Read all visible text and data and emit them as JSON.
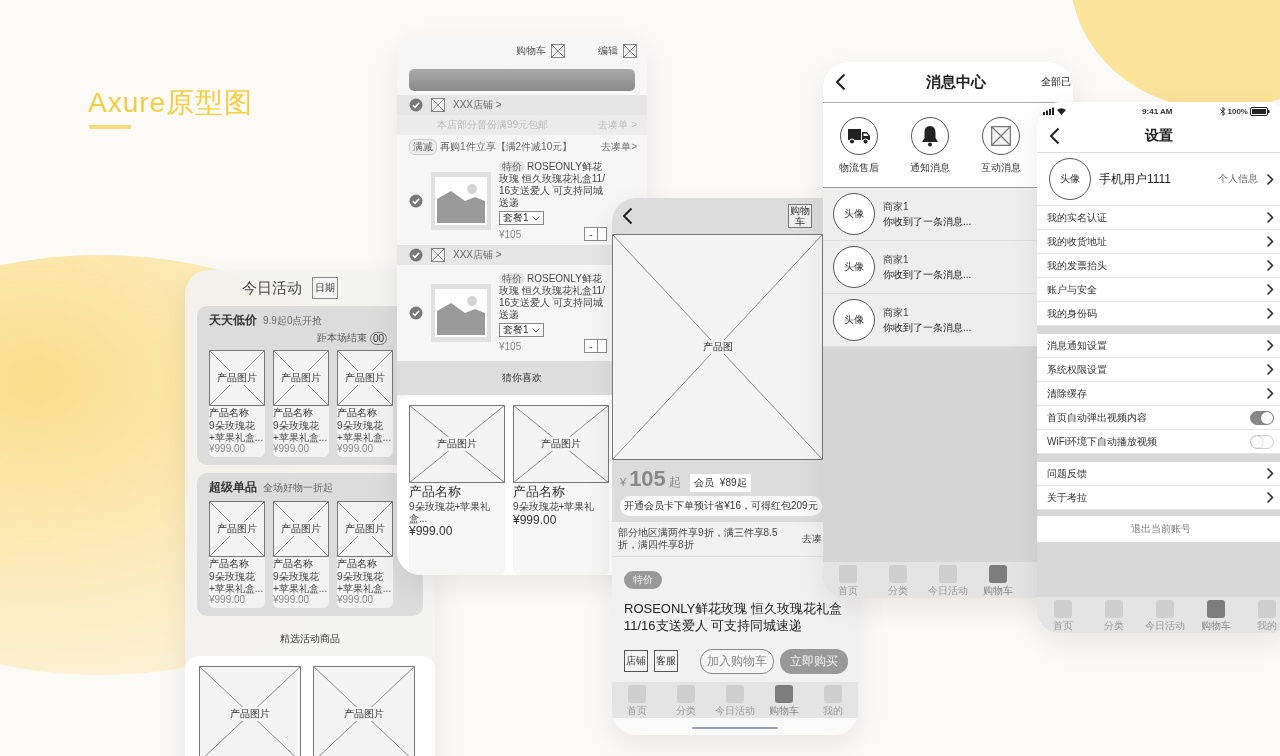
{
  "heading": "Axure原型图",
  "activity": {
    "title": "今日活动",
    "date_button": "日期",
    "sections": [
      {
        "title": "天天低价",
        "subtitle": "9.9起0点开抢",
        "countdown_label": "距本场结束",
        "countdown": "00",
        "products": [
          {
            "image_label": "产品图片",
            "name": "产品名称",
            "desc": "9朵玫瑰花+苹果礼盒...",
            "price": "¥999.00"
          },
          {
            "image_label": "产品图片",
            "name": "产品名称",
            "desc": "9朵玫瑰花+苹果礼盒...",
            "price": "¥999.00"
          },
          {
            "image_label": "产品图片",
            "name": "产品名称",
            "desc": "9朵玫瑰花+苹果礼盒...",
            "price": "¥999.00"
          }
        ]
      },
      {
        "title": "超级单品",
        "subtitle": "全场好物一折起",
        "products": [
          {
            "image_label": "产品图片",
            "name": "产品名称",
            "desc": "9朵玫瑰花+苹果礼盒...",
            "price": "¥999.00"
          },
          {
            "image_label": "产品图片",
            "name": "产品名称",
            "desc": "9朵玫瑰花+苹果礼盒...",
            "price": "¥999.00"
          },
          {
            "image_label": "产品图片",
            "name": "产品名称",
            "desc": "9朵玫瑰花+苹果礼盒...",
            "price": "¥999.00"
          }
        ]
      }
    ],
    "featured_title": "精选活动商品",
    "featured_products": [
      {
        "image_label": "产品图片"
      },
      {
        "image_label": "产品图片"
      }
    ]
  },
  "cart": {
    "title": "购物车",
    "edit": "编辑",
    "stores": [
      {
        "name": "XXX店铺 >",
        "checked": true,
        "notice": "本店部分普份满99元包邮",
        "notice_link": "去凑单 >",
        "promo_tag": "满减",
        "promo": "再购1件立享【满2件减10元】",
        "promo_link": "去凑单>",
        "items": [
          {
            "tag": "特价",
            "title": "ROSEONLY鲜花玫瑰 恒久玫瑰花礼盒11/16支送爱人 可支持同城送递",
            "spec": "套餐1",
            "price": "¥105",
            "minus": "-",
            "checked": true
          }
        ]
      },
      {
        "name": "XXX店铺 >",
        "checked": true,
        "items": [
          {
            "tag": "特价",
            "title": "ROSEONLY鲜花玫瑰 恒久玫瑰花礼盒11/16支送爱人 可支持同城送递",
            "spec": "套餐1",
            "price": "¥105",
            "minus": "-",
            "checked": true
          }
        ]
      }
    ],
    "recommend_title": "猜你喜欢",
    "products": [
      {
        "image_label": "产品图片",
        "name": "产品名称",
        "desc": "9朵玫瑰花+苹果礼盒...",
        "price": "¥999.00"
      },
      {
        "image_label": "产品图片",
        "name": "产品名称",
        "desc": "9朵玫瑰花+苹果礼",
        "price": "¥999.00"
      }
    ]
  },
  "detail": {
    "cart_button": "购物车",
    "image_label": "产品图",
    "currency": "¥",
    "price": "105",
    "price_suffix": "起",
    "member_tag": "会员",
    "member_price": "¥89起",
    "member_promo": "开通会员卡下单预计省¥16，可得红包209元",
    "discount_note": "部分地区满两件享9折，满三件享8.5折，满四件享8折",
    "discount_link": "去凑",
    "tag": "特价",
    "title": "ROSEONLY鲜花玫瑰 恒久玫瑰花礼盒 11/16支送爱人 可支持同城速递",
    "shop_button": "店铺",
    "service_button": "客服",
    "add_cart": "加入购物车",
    "buy_now": "立即购买",
    "tabs": [
      {
        "label": "首页",
        "selected": false
      },
      {
        "label": "分类",
        "selected": false
      },
      {
        "label": "今日活动",
        "selected": false
      },
      {
        "label": "购物车",
        "selected": true
      },
      {
        "label": "我的",
        "selected": false
      }
    ]
  },
  "messages": {
    "title": "消息中心",
    "header_link": "全部已",
    "categories": [
      {
        "kind": "truck",
        "label": "物流售后"
      },
      {
        "kind": "bell",
        "label": "通知消息"
      },
      {
        "kind": "placeholder",
        "label": "互动消息"
      }
    ],
    "items": [
      {
        "avatar": "头像",
        "sender": "商家1",
        "preview": "你收到了一条消息..."
      },
      {
        "avatar": "头像",
        "sender": "商家1",
        "preview": "你收到了一条消息..."
      },
      {
        "avatar": "头像",
        "sender": "商家1",
        "preview": "你收到了一条消息..."
      }
    ],
    "tabs": [
      {
        "label": "首页",
        "selected": false
      },
      {
        "label": "分类",
        "selected": false
      },
      {
        "label": "今日活动",
        "selected": false
      },
      {
        "label": "购物车",
        "selected": true
      }
    ]
  },
  "settings": {
    "time": "9:41 AM",
    "battery": "100%",
    "title": "设置",
    "profile": {
      "avatar": "头像",
      "name": "手机用户1111",
      "link": "个人信息"
    },
    "groups": [
      {
        "rows": [
          {
            "kind": "link",
            "label": "我的实名认证"
          },
          {
            "kind": "link",
            "label": "我的收货地址"
          },
          {
            "kind": "link",
            "label": "我的发票抬头"
          },
          {
            "kind": "link",
            "label": "账户与安全"
          },
          {
            "kind": "link",
            "label": "我的身份码"
          }
        ]
      },
      {
        "rows": [
          {
            "kind": "link",
            "label": "消息通知设置"
          },
          {
            "kind": "link",
            "label": "系统权限设置"
          },
          {
            "kind": "link",
            "label": "清除缓存"
          },
          {
            "kind": "toggle",
            "label": "首页自动弹出视频内容",
            "on": true
          },
          {
            "kind": "toggle",
            "label": "WiFi环境下自动播放视频",
            "on": false
          }
        ]
      },
      {
        "rows": [
          {
            "kind": "link",
            "label": "问题反馈"
          },
          {
            "kind": "link",
            "label": "关于考拉"
          }
        ]
      }
    ],
    "logout": "退出当前账号",
    "tabs": [
      {
        "label": "首页",
        "selected": false
      },
      {
        "label": "分类",
        "selected": false
      },
      {
        "label": "今日活动",
        "selected": false
      },
      {
        "label": "购物车",
        "selected": true
      },
      {
        "label": "我的",
        "selected": false
      }
    ]
  }
}
